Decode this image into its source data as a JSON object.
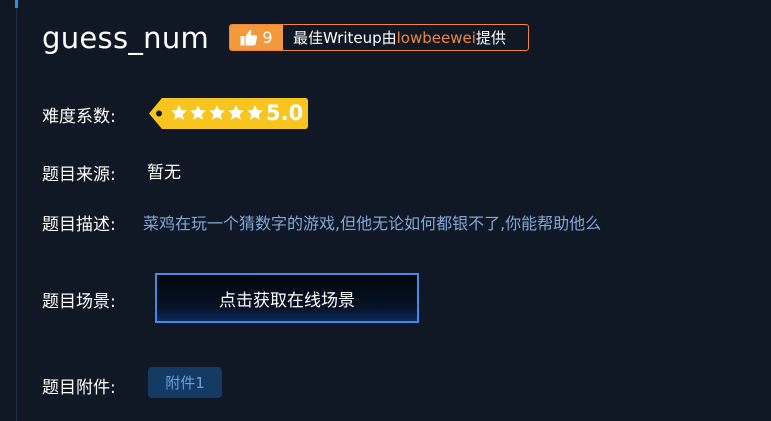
{
  "challenge": {
    "title": "guess_num"
  },
  "writeup": {
    "likes": "9",
    "prefix": "最佳Writeup由",
    "author": "lowbeewei",
    "suffix": "提供"
  },
  "difficulty": {
    "label": "难度系数:",
    "score": "5.0",
    "stars": 5,
    "stars_max": 5,
    "tag_color": "#f7c51e"
  },
  "source": {
    "label": "题目来源:",
    "value": "暂无"
  },
  "description": {
    "label": "题目描述:",
    "value": "菜鸡在玩一个猜数字的游戏,但他无论如何都银不了,你能帮助他么"
  },
  "scene": {
    "label": "题目场景:",
    "button_label": "点击获取在线场景"
  },
  "attachment": {
    "label": "题目附件:",
    "file_label": "附件1"
  },
  "icons": {
    "likes": "thumbs-up-icon",
    "star": "star-icon"
  },
  "colors": {
    "background": "#0f1824",
    "accent_orange": "#f0873b",
    "accent_blue": "#3f8de6",
    "description_text": "#7fa8d8"
  }
}
